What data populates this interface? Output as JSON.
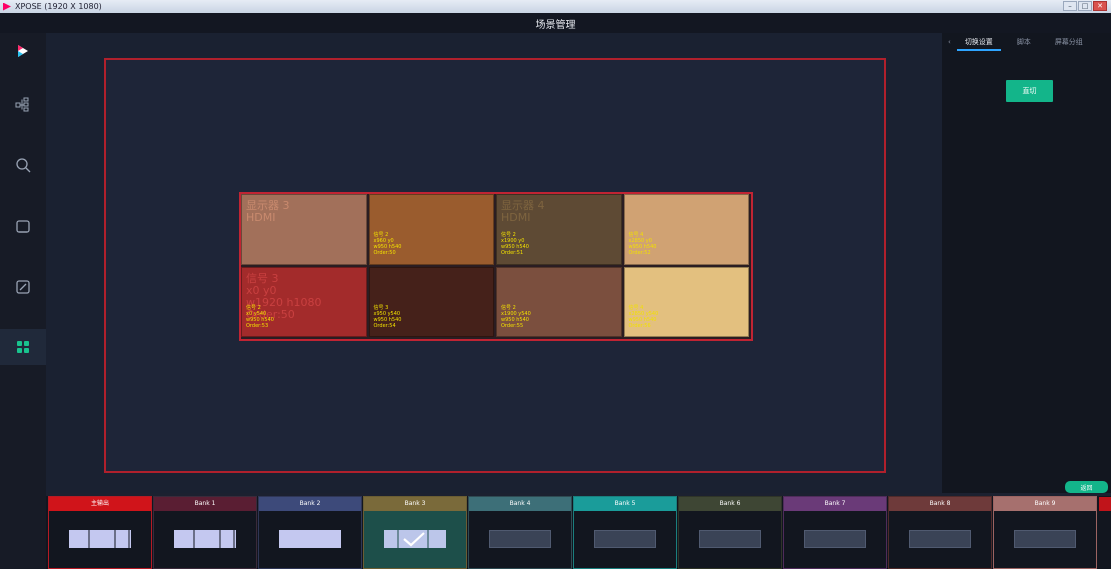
{
  "window": {
    "title": "XPOSE (1920 X 1080)",
    "controls": [
      "minimize",
      "restore",
      "close"
    ]
  },
  "header": {
    "title": "场景管理"
  },
  "sidebar": {
    "items": [
      {
        "icon": "play-logo-icon"
      },
      {
        "icon": "topology-icon"
      },
      {
        "icon": "search-icon"
      },
      {
        "icon": "monitor-icon"
      },
      {
        "icon": "edit-icon"
      },
      {
        "icon": "grid-icon",
        "active": true
      }
    ]
  },
  "right_panel": {
    "collapse_glyph": "‹",
    "tabs": [
      {
        "label": "切换设置",
        "active": true
      },
      {
        "label": "脚本"
      },
      {
        "label": "屏幕分组"
      }
    ],
    "cut_button": "直切",
    "back_button": "返回"
  },
  "screen_tiles": [
    {
      "big": "显示器 3\nHDMI",
      "small": "",
      "bg": "#a2705a",
      "color": "#c98a6e"
    },
    {
      "big": "",
      "small": "信号 2\nx960 y0\nw950 h540\nOrder:50",
      "bg": "#9a5c2e",
      "color": "#c07842"
    },
    {
      "big": "显示器 4\nHDMI",
      "small": "信号 2\nx1900 y0\nw950 h540\nOrder:51",
      "bg": "#5e4a34",
      "color": "#7e643f"
    },
    {
      "big": "",
      "small": "信号 4\nx2850 y0\nw950 h540\nOrder:52",
      "bg": "#d0a273",
      "color": "#e8b88a"
    },
    {
      "big": "信号 3\nx0 y0\nw1920 h1080\nOrder:50",
      "small": "信号 2\nx0 y540\nw950 h540\nOrder:53",
      "bg": "#a32b2b",
      "color": "#c94040"
    },
    {
      "big": "",
      "small": "信号 3\nx950 y540\nw950 h540\nOrder:54",
      "bg": "#45211a",
      "color": "#6a2a20"
    },
    {
      "big": "",
      "small": "信号 2\nx1900 y540\nw950 h540\nOrder:55",
      "bg": "#7b4f3e",
      "color": "#9a6450"
    },
    {
      "big": "",
      "small": "信号 4\nx2850 y540\nw950 h540\nOrder:56",
      "bg": "#e3c07f",
      "color": "#f0d498"
    }
  ],
  "banks": [
    {
      "label": "主输出",
      "color": "#d0141a",
      "border": "#b51a24",
      "thumb": "split3",
      "selected": false
    },
    {
      "label": "Bank 1",
      "color": "#5a1e33",
      "border": "#3a2a3a",
      "thumb": "split3",
      "selected": false
    },
    {
      "label": "Bank 2",
      "color": "#3d4a7a",
      "border": "#2f3656",
      "thumb": "full-light",
      "selected": false
    },
    {
      "label": "Bank 3",
      "color": "#7a6a3a",
      "border": "#6a5d33",
      "thumb": "check",
      "selected": true
    },
    {
      "label": "Bank 4",
      "color": "#3d6f78",
      "border": "#2f4a52",
      "thumb": "dark",
      "selected": false
    },
    {
      "label": "Bank 5",
      "color": "#1a9c9a",
      "border": "#1a7f7e",
      "thumb": "dark",
      "selected": false
    },
    {
      "label": "Bank 6",
      "color": "#3e4634",
      "border": "#2f3428",
      "thumb": "dark",
      "selected": false
    },
    {
      "label": "Bank 7",
      "color": "#6a3a78",
      "border": "#4f2c5a",
      "thumb": "dark",
      "selected": false
    },
    {
      "label": "Bank 8",
      "color": "#6e3a3a",
      "border": "#4f2a2a",
      "thumb": "dark",
      "selected": false
    },
    {
      "label": "Bank 9",
      "color": "#a6706e",
      "border": "#9c6462",
      "thumb": "dark",
      "selected": false
    }
  ],
  "colors": {
    "accent": "#13b58a",
    "canvas_border": "#b0202c",
    "tab_active": "#2ea4ff"
  }
}
